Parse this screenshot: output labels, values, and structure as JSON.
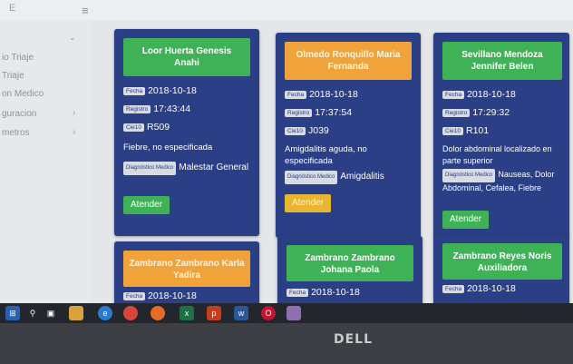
{
  "topbar": {
    "menu_glyph": "≡",
    "letter": "E"
  },
  "sidebar": {
    "items": [
      {
        "label": "io Triaje",
        "has_chevron": false
      },
      {
        "label": "Triaje",
        "has_chevron": false
      },
      {
        "label": "on Medico",
        "has_chevron": false
      },
      {
        "label": "guracion",
        "has_chevron": true
      },
      {
        "label": "metros",
        "has_chevron": true
      }
    ]
  },
  "labels": {
    "fecha": "Fecha",
    "registro": "Registro",
    "cie10": "Cie10",
    "diagnostico_medico": "Diagnóstico Medico",
    "atender": "Atender"
  },
  "cards": [
    {
      "name": "Loor Huerta Genesis Anahi",
      "header_color": "green",
      "fecha": "2018-10-18",
      "registro": "17:43:44",
      "cie10": "R509",
      "diagnosis": "Fiebre, no especificada",
      "diag_medico": "Malestar General",
      "button_color": "green"
    },
    {
      "name": "Olmedo Ronquillo Maria Fernanda",
      "header_color": "orange",
      "fecha": "2018-10-18",
      "registro": "17:37:54",
      "cie10": "J039",
      "diagnosis": "Amigdalitis aguda, no especificada",
      "diag_medico": "Amigdalitis",
      "button_color": "yellow"
    },
    {
      "name": "Sevillano Mendoza Jennifer Belen",
      "header_color": "green",
      "fecha": "2018-10-18",
      "registro": "17:29:32",
      "cie10": "R101",
      "diagnosis": "Dolor abdominal localizado en parte superior",
      "diag_medico": "Nauseas, Dolor Abdominal, Cefalea, Fiebre",
      "button_color": "green"
    },
    {
      "name": "Zambrano Zambrano Karla Yadira",
      "header_color": "orange",
      "fecha": "2018-10-18"
    },
    {
      "name": "Zambrano Zambrano Johana Paola",
      "header_color": "green",
      "fecha": "2018-10-18"
    },
    {
      "name": "Zambrano Reyes Noris Auxiliadora",
      "header_color": "green",
      "fecha": "2018-10-18"
    }
  ],
  "colors": {
    "card_bg": "#2a3f86",
    "green": "#3fb157",
    "orange": "#f0a33a",
    "yellow_button": "#e8b530"
  },
  "taskbar": {
    "icons": [
      "windows-start-icon",
      "search-icon",
      "task-view-icon",
      "folder-icon",
      "edge-icon",
      "chrome-icon",
      "firefox-icon",
      "excel-icon",
      "powerpoint-icon",
      "word-icon",
      "opera-icon",
      "app-icon"
    ]
  },
  "bezel": {
    "brand": "DELL"
  }
}
